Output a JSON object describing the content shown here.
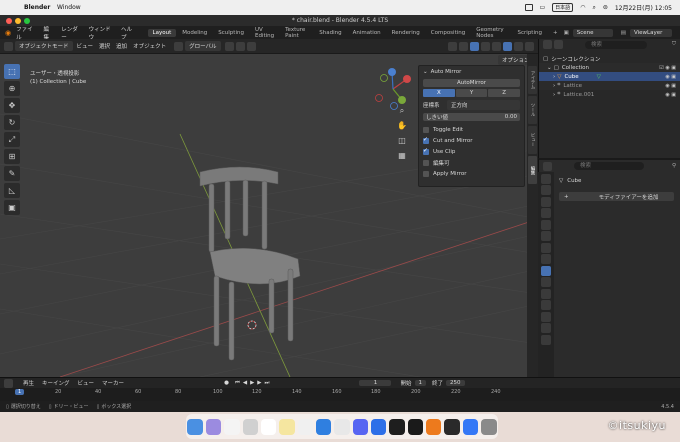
{
  "menubar": {
    "app": "Blender",
    "window": "Window",
    "ime": "日本語",
    "datetime": "12月22日(月)  12:05"
  },
  "window": {
    "title": "* chair.blend - Blender 4.5.4 LTS"
  },
  "topmenu": [
    "ファイル",
    "編集",
    "レンダー",
    "ウィンドウ",
    "ヘルプ"
  ],
  "workspaces": [
    "Layout",
    "Modeling",
    "Sculpting",
    "UV Editing",
    "Texture Paint",
    "Shading",
    "Animation",
    "Rendering",
    "Compositing",
    "Geometry Nodes",
    "Scripting"
  ],
  "viewport_header": {
    "mode": "オブジェクトモード",
    "menus": [
      "ビュー",
      "選択",
      "追加",
      "オブジェクト"
    ],
    "orientation": "グローバル",
    "options": "オプション"
  },
  "viewport": {
    "view_name": "ユーザー・透視投影",
    "collection_info": "(1) Collection | Cube"
  },
  "npanel": {
    "title": "Auto Mirror",
    "button": "AutoMirror",
    "axes": [
      "X",
      "Y",
      "Z"
    ],
    "axis_label": "座標系",
    "axis_value": "正方向",
    "threshold_label": "しきい値",
    "threshold_value": "0.00",
    "options": [
      {
        "label": "Toggle Edit",
        "checked": false
      },
      {
        "label": "Cut and Mirror",
        "checked": true
      },
      {
        "label": "Use Clip",
        "checked": true
      },
      {
        "label": "編集可",
        "checked": false
      },
      {
        "label": "Apply Mirror",
        "checked": false
      }
    ],
    "tabs": [
      "アイテム",
      "ツール",
      "ビュー",
      "編集"
    ]
  },
  "topright": {
    "scene": "Scene",
    "viewlayer": "ViewLayer"
  },
  "outliner": {
    "search_placeholder": "検索",
    "root": "シーンコレクション",
    "collection": "Collection",
    "items": [
      "Cube",
      "Lattice",
      "Lattice.001"
    ]
  },
  "properties": {
    "search_placeholder": "検索",
    "object": "Cube",
    "add_modifier": "モディファイアーを追加"
  },
  "timeline": {
    "menus": [
      "再生",
      "キーイング",
      "ビュー",
      "マーカー"
    ],
    "current_frame": "1",
    "start_label": "開始",
    "start_value": "1",
    "end_label": "終了",
    "end_value": "250",
    "ruler": [
      "1",
      "20",
      "40",
      "60",
      "80",
      "100",
      "120",
      "140",
      "160",
      "180",
      "200",
      "220",
      "240"
    ]
  },
  "statusbar": {
    "left": [
      "選択切り替え",
      "ドリー・ビュー",
      "ボックス選択"
    ],
    "version": "4.5.4"
  },
  "watermark": "©itsukiyu",
  "colors": {
    "accent": "#4772b3",
    "outliner_selected": "#334d80",
    "viewport_bg": "#3d3d3d"
  }
}
